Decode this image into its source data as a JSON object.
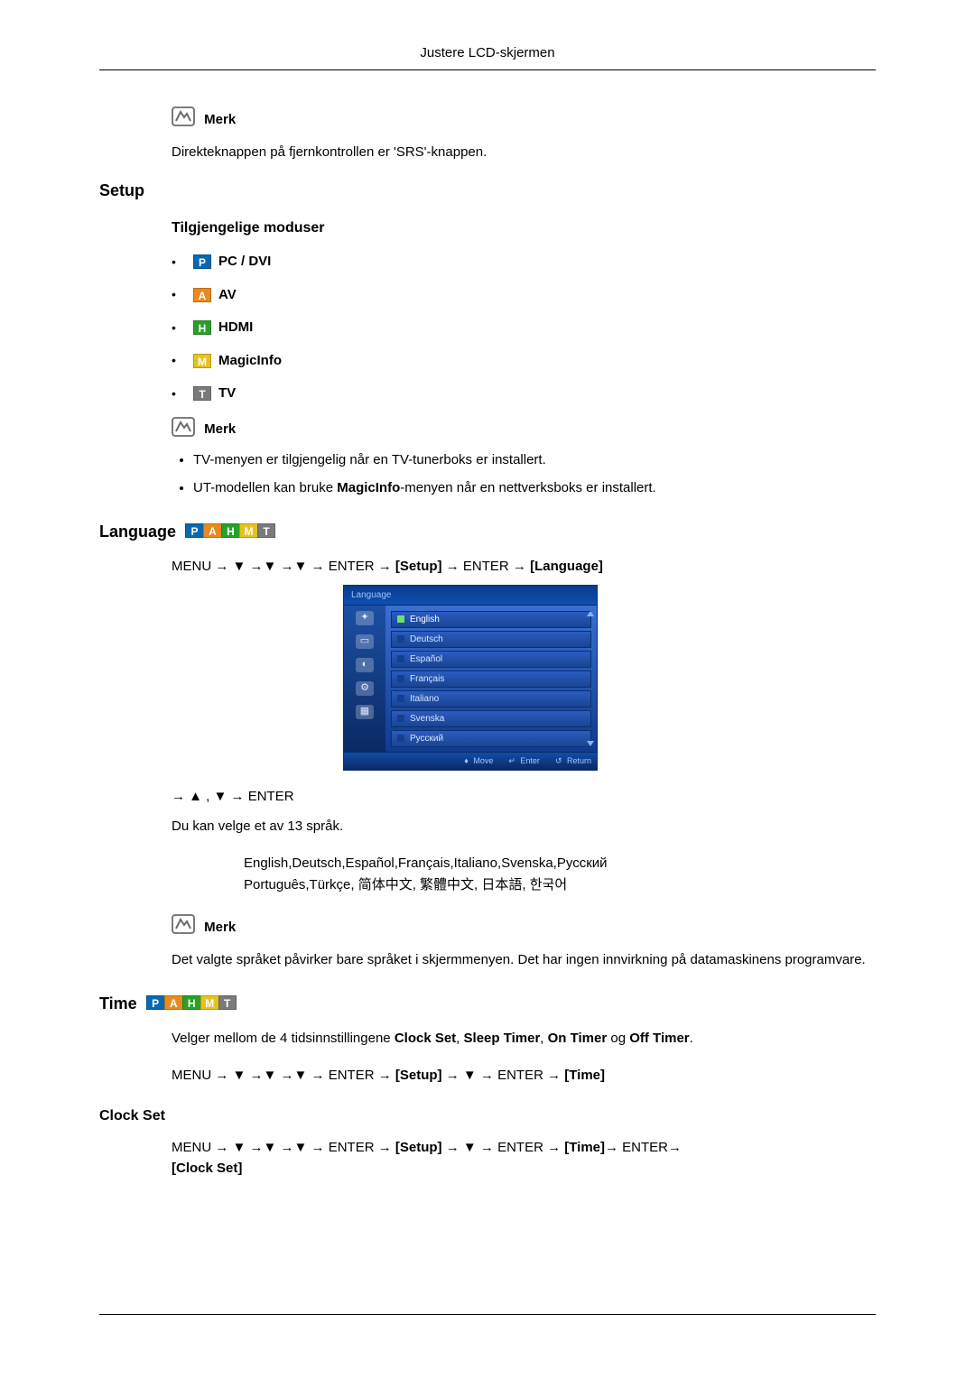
{
  "header": {
    "title": "Justere LCD-skjermen"
  },
  "note_label": "Merk",
  "srs_note": "Direkteknappen på fjernkontrollen er 'SRS'-knappen.",
  "setup": {
    "title": "Setup",
    "modes_title": "Tilgjengelige moduser",
    "modes": [
      {
        "letter": "P",
        "label": "PC / DVI",
        "cls": "chip-p"
      },
      {
        "letter": "A",
        "label": "AV",
        "cls": "chip-a"
      },
      {
        "letter": "H",
        "label": "HDMI",
        "cls": "chip-h"
      },
      {
        "letter": "M",
        "label": "MagicInfo",
        "cls": "chip-m"
      },
      {
        "letter": "T",
        "label": "TV",
        "cls": "chip-t"
      }
    ],
    "notes": [
      "TV-menyen er tilgjengelig når en TV-tunerboks er installert.",
      "UT-modellen kan bruke MagicInfo-menyen når en nettverksboks er installert."
    ],
    "notes_bold": {
      "b1": "MagicInfo"
    }
  },
  "language": {
    "title": "Language",
    "path_parts": {
      "p1": "MENU → ▼ →▼ →▼ → ENTER → ",
      "setup": "[Setup]",
      "p2": " → ENTER → ",
      "lang": "[Language]"
    },
    "osd": {
      "header": "Language",
      "options": [
        "English",
        "Deutsch",
        "Español",
        "Français",
        "Italiano",
        "Svenska",
        "Русский"
      ],
      "footer": {
        "move": "Move",
        "enter": "Enter",
        "return": "Return"
      }
    },
    "path2": "→ ▲ , ▼ → ENTER",
    "choose_text": "Du kan velge et av 13 språk.",
    "lang_lines": {
      "l1": "English,Deutsch,Español,Français,Italiano,Svenska,Русский",
      "l2": "Português,Türkçe, 简体中文,  繁體中文, 日本語, 한국어"
    },
    "note_text": "Det valgte språket påvirker bare språket i skjermmenyen. Det har ingen innvirkning på datamaskinens programvare."
  },
  "time": {
    "title": "Time",
    "intro_parts": {
      "a": "Velger mellom de 4 tidsinnstillingene ",
      "b1": "Clock Set",
      "c1": ", ",
      "b2": "Sleep Timer",
      "c2": ", ",
      "b3": "On Timer",
      "c3": " og ",
      "b4": "Off Timer",
      "c4": "."
    },
    "path_parts": {
      "p1": "MENU → ▼ →▼ →▼ → ENTER → ",
      "setup": "[Setup]",
      "p2": " → ▼ → ENTER → ",
      "time": "[Time]"
    }
  },
  "clock_set": {
    "title": "Clock Set",
    "path_parts": {
      "p1": "MENU → ▼ →▼ →▼ → ENTER → ",
      "setup": "[Setup]",
      "p2": " → ▼ → ENTER → ",
      "time": "[Time]",
      "p3": "→ ENTER→ ",
      "cs": "[Clock Set]"
    }
  }
}
